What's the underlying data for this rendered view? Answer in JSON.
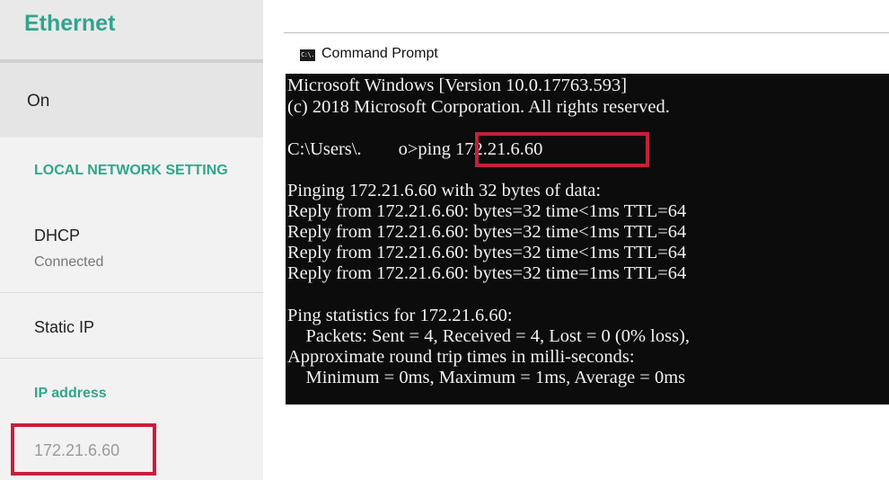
{
  "settings": {
    "header_title": "Ethernet",
    "state": "On",
    "local_section": "LOCAL NETWORK SETTING",
    "dhcp": {
      "label": "DHCP",
      "status": "Connected"
    },
    "static_ip": {
      "label": "Static IP"
    },
    "ip_section": "IP address",
    "ip_value": "172.21.6.60"
  },
  "cmd": {
    "title": "Command Prompt",
    "icon": "console-icon",
    "icon_glyph": "C:\\.",
    "lines": [
      "Microsoft Windows [Version 10.0.17763.593]",
      "(c) 2018 Microsoft Corporation. All rights reserved.",
      "C:\\Users\\.        o>ping 172.21.6.60",
      "Pinging 172.21.6.60 with 32 bytes of data:",
      "Reply from 172.21.6.60: bytes=32 time<1ms TTL=64",
      "Reply from 172.21.6.60: bytes=32 time<1ms TTL=64",
      "Reply from 172.21.6.60: bytes=32 time<1ms TTL=64",
      "Reply from 172.21.6.60: bytes=32 time=1ms TTL=64",
      "Ping statistics for 172.21.6.60:",
      "    Packets: Sent = 4, Received = 4, Lost = 0 (0% loss),",
      "Approximate round trip times in milli-seconds:",
      "    Minimum = 0ms, Maximum = 1ms, Average = 0ms"
    ]
  },
  "colors": {
    "accent": "#2fa58c",
    "highlight": "#c5203a",
    "console_bg": "#0c0c0c"
  }
}
